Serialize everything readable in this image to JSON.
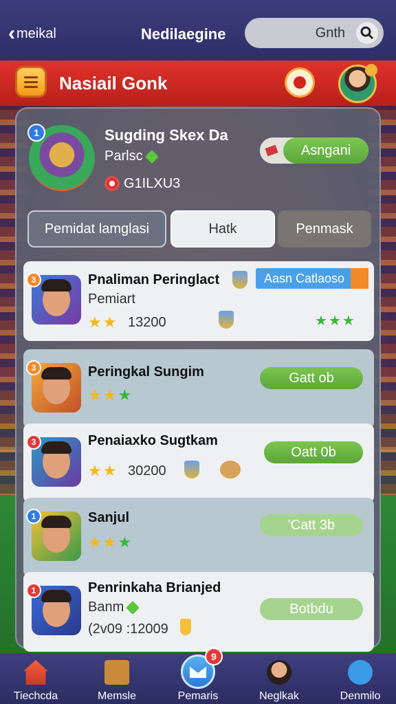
{
  "topbar": {
    "back_label": "meikal",
    "title": "Nedilaegine",
    "search_value": "Gnth"
  },
  "header": {
    "title": "Nasiail Gonk"
  },
  "profile": {
    "level": "1",
    "name": "Sugding Skex Da",
    "subtitle": "Parlsc",
    "coins": "G1ILXU3",
    "assign_label": "Asngani"
  },
  "tabs": [
    {
      "label": "Pemidat lamglasi"
    },
    {
      "label": "Hatk"
    },
    {
      "label": "Penmask"
    }
  ],
  "rows": [
    {
      "rank": "3",
      "name": "Pnaliman Peringlact",
      "subtitle": "Pemiart",
      "score": "13200",
      "tag": "Aasn Catlaoso",
      "stars": 2
    },
    {
      "rank": "3",
      "name": "Peringkal Sungim",
      "subtitle": "",
      "score": "",
      "button": "Gatt ob",
      "stars": 3
    },
    {
      "rank": "3",
      "name": "Penaiaxko Sugtkam",
      "subtitle": "",
      "score": "30200",
      "button": "Oatt 0b",
      "stars": 2
    },
    {
      "rank": "1",
      "name": "Sanjul",
      "subtitle": "",
      "score": "",
      "button": "'Catt 3b",
      "stars": 2
    },
    {
      "rank": "1",
      "name": "Penrinkaha Brianjed",
      "subtitle": "Banm",
      "score": "(2v09 :12009",
      "button": "Botbdu",
      "stars": 0
    }
  ],
  "nav": [
    {
      "label": "Tiechcda",
      "icon": "home-icon"
    },
    {
      "label": "Memsle",
      "icon": "box-icon"
    },
    {
      "label": "Pemaris",
      "icon": "mail-icon",
      "badge": "9"
    },
    {
      "label": "Neglkak",
      "icon": "face-icon"
    },
    {
      "label": "Denmilo",
      "icon": "person-icon"
    }
  ],
  "colors": {
    "topbar": "#2e2f68",
    "header": "#d12a22",
    "accent_green": "#5aa73a",
    "panel": "#5c6070"
  }
}
